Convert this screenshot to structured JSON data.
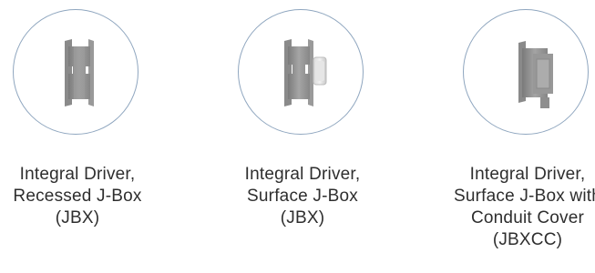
{
  "options": [
    {
      "icon": "jbx-recessed-driver-icon",
      "lines": [
        "Integral Driver,",
        "Recessed J-Box",
        "(JBX)"
      ]
    },
    {
      "icon": "jbx-surface-driver-icon",
      "lines": [
        "Integral Driver,",
        "Surface J-Box",
        "(JBX)"
      ]
    },
    {
      "icon": "jbxcc-conduit-cover-icon",
      "lines": [
        "Integral Driver,",
        "Surface J-Box with",
        "Conduit Cover",
        "(JBXCC)"
      ]
    }
  ],
  "colors": {
    "ring": "#8fa6bf",
    "text": "#2e2e2e",
    "metal": "#8c8c8c"
  }
}
